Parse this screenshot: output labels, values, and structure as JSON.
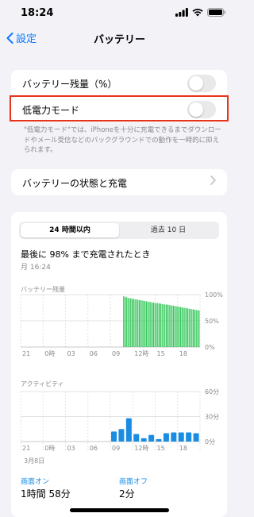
{
  "status": {
    "time": "18:24"
  },
  "nav": {
    "back_label": "設定",
    "title": "バッテリー"
  },
  "settings": {
    "battery_percentage_label": "バッテリー残量（%）",
    "battery_percentage_on": false,
    "low_power_label": "低電力モード",
    "low_power_on": false,
    "footnote": "\"低電力モード\"では、iPhoneを十分に充電できるまでダウンロードやメール受信などのバックグラウンドでの動作を一時的に抑えられます。",
    "health_label": "バッテリーの状態と充電"
  },
  "usage": {
    "tabs": [
      "24 時間以内",
      "過去 10 日"
    ],
    "selected_tab": 0,
    "charged_title": "最後に 98% まで充電されたとき",
    "charged_time": "月 16:24",
    "battery_level_label": "バッテリー残量",
    "activity_label": "アクティビティ",
    "date_label": "3月8日",
    "screen_on_label": "画面オン",
    "screen_on_value": "1時間 58分",
    "screen_off_label": "画面オフ",
    "screen_off_value": "2分"
  },
  "chart_data": [
    {
      "type": "bar",
      "title": "バッテリー残量",
      "y_ticks": [
        "100%",
        "50%",
        "0%"
      ],
      "ylim": [
        0,
        100
      ],
      "x_ticks": [
        "21",
        "0時",
        "03",
        "06",
        "09",
        "12時",
        "15",
        "18"
      ],
      "color": "#34c759",
      "values": [
        0,
        0,
        0,
        0,
        0,
        0,
        0,
        0,
        0,
        0,
        0,
        0,
        0,
        0,
        0,
        0,
        0,
        0,
        0,
        0,
        0,
        0,
        0,
        0,
        0,
        0,
        0,
        0,
        0,
        0,
        0,
        0,
        0,
        0,
        0,
        0,
        0,
        0,
        0,
        0,
        0,
        0,
        0,
        0,
        0,
        0,
        0,
        0,
        0,
        0,
        0,
        0,
        0,
        0,
        0,
        0,
        0,
        0,
        0,
        0,
        0,
        0,
        0,
        0,
        0,
        0,
        0,
        0,
        0,
        0,
        0,
        0,
        97,
        96,
        95,
        94,
        93,
        93,
        92,
        92,
        91,
        91,
        90,
        90,
        89,
        89,
        88,
        88,
        87,
        87,
        86,
        86,
        85,
        85,
        84,
        84,
        84,
        83,
        83,
        82,
        82,
        81,
        81,
        81,
        80,
        80,
        79,
        79,
        78,
        78,
        77,
        77,
        76,
        76,
        75,
        75,
        74,
        74,
        73,
        73,
        72,
        72,
        71,
        71,
        70,
        70
      ]
    },
    {
      "type": "bar",
      "title": "アクティビティ",
      "y_ticks": [
        "60分",
        "30分",
        "0分"
      ],
      "ylim": [
        0,
        60
      ],
      "x_ticks": [
        "21",
        "0時",
        "03",
        "06",
        "09",
        "12時",
        "15",
        "18"
      ],
      "color": "#1a8de3",
      "values": [
        0,
        0,
        0,
        0,
        0,
        0,
        0,
        0,
        0,
        0,
        0,
        0,
        0,
        0,
        0,
        0,
        0,
        0,
        0,
        0,
        0,
        0,
        0,
        0,
        0,
        0,
        0,
        0,
        0,
        0,
        0,
        0,
        0,
        0,
        0,
        0,
        0,
        0,
        0,
        0,
        0,
        0,
        0,
        0,
        0,
        0,
        0,
        0,
        0,
        0,
        0,
        0,
        0,
        0,
        0,
        0,
        0,
        0,
        0,
        0,
        0,
        0,
        0,
        0,
        0,
        0,
        0,
        0,
        0,
        0,
        0,
        0,
        12,
        15,
        28,
        9,
        4,
        8,
        3,
        10,
        11,
        11,
        11,
        10,
        0,
        0,
        0,
        0,
        0,
        0,
        0,
        0,
        0,
        0,
        0,
        0,
        0,
        0,
        0,
        0,
        0,
        0,
        0,
        0,
        0,
        0,
        0,
        0,
        0,
        0,
        0,
        0,
        0,
        0,
        0,
        0,
        0,
        0,
        0,
        0,
        0,
        0,
        0,
        0,
        0,
        0,
        0,
        0,
        0,
        0,
        0,
        0,
        0,
        0,
        0,
        0,
        0,
        0,
        0,
        0
      ],
      "hourly_values": [
        0,
        0,
        0,
        0,
        0,
        0,
        0,
        0,
        0,
        0,
        0,
        0,
        12,
        15,
        28,
        9,
        4,
        8,
        3,
        10,
        11,
        11,
        11,
        10
      ]
    }
  ]
}
